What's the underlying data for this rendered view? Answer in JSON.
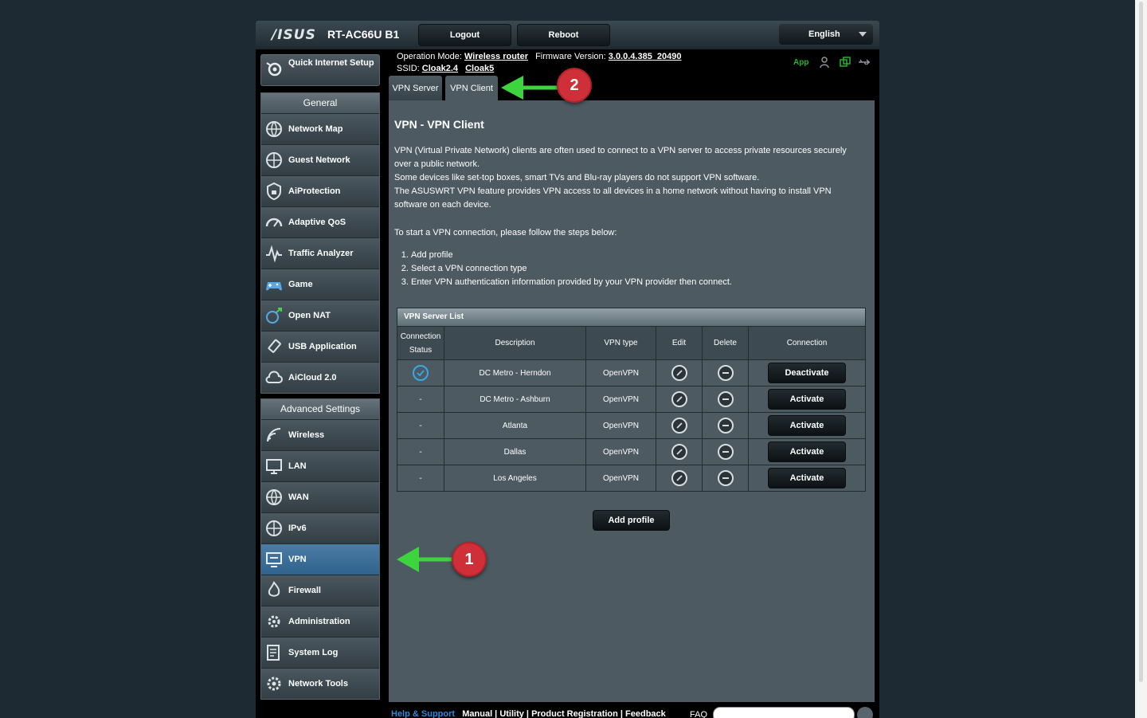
{
  "header": {
    "logo": "/ISUS",
    "model": "RT-AC66U B1",
    "logout": "Logout",
    "reboot": "Reboot",
    "language": "English"
  },
  "status": {
    "op_mode_label": "Operation Mode:",
    "op_mode_value": "Wireless router",
    "firmware_label": "Firmware Version:",
    "firmware_value": "3.0.0.4.385_20490",
    "ssid_label": "SSID:",
    "ssid_1": "Cloak2.4",
    "ssid_2": "Cloak5",
    "app_label": "App"
  },
  "sidebar": {
    "quick_setup": "Quick Internet Setup",
    "general_title": "General",
    "general_items": [
      {
        "label": "Network Map",
        "icon": "globe-network-icon"
      },
      {
        "label": "Guest Network",
        "icon": "guest-globe-icon"
      },
      {
        "label": "AiProtection",
        "icon": "shield-lock-icon"
      },
      {
        "label": "Adaptive QoS",
        "icon": "speedometer-icon"
      },
      {
        "label": "Traffic Analyzer",
        "icon": "traffic-wave-icon"
      },
      {
        "label": "Game",
        "icon": "gamepad-icon"
      },
      {
        "label": "Open NAT",
        "icon": "open-nat-icon"
      },
      {
        "label": "USB Application",
        "icon": "usb-icon"
      },
      {
        "label": "AiCloud 2.0",
        "icon": "cloud-icon"
      }
    ],
    "advanced_title": "Advanced Settings",
    "advanced_items": [
      {
        "label": "Wireless",
        "icon": "wifi-icon"
      },
      {
        "label": "LAN",
        "icon": "lan-monitor-icon"
      },
      {
        "label": "WAN",
        "icon": "wan-globe-icon"
      },
      {
        "label": "IPv6",
        "icon": "ipv6-globe-icon"
      },
      {
        "label": "VPN",
        "icon": "vpn-monitor-icon"
      },
      {
        "label": "Firewall",
        "icon": "firewall-flame-icon"
      },
      {
        "label": "Administration",
        "icon": "admin-gear-icon"
      },
      {
        "label": "System Log",
        "icon": "log-pencil-icon"
      },
      {
        "label": "Network Tools",
        "icon": "tools-gear-icon"
      }
    ]
  },
  "tabs": {
    "server": "VPN Server",
    "client": "VPN Client"
  },
  "main": {
    "title": "VPN - VPN Client",
    "desc_1": "VPN (Virtual Private Network) clients are often used to connect to a VPN server to access private resources securely over a public network.",
    "desc_2": "Some devices like set-top boxes, smart TVs and Blu-ray players do not support VPN software.",
    "desc_3": "The ASUSWRT VPN feature provides VPN access to all devices in a home network without having to install VPN software on each device.",
    "steps_intro": "To start a VPN connection, please follow the steps below:",
    "steps": [
      "Add profile",
      "Select a VPN connection type",
      "Enter VPN authentication information provided by your VPN provider then connect."
    ],
    "add_profile": "Add profile"
  },
  "table": {
    "title": "VPN Server List",
    "headers": {
      "status": "Connection Status",
      "description": "Description",
      "type": "VPN type",
      "edit": "Edit",
      "delete": "Delete",
      "connection": "Connection"
    },
    "rows": [
      {
        "status": "",
        "description": "DC Metro - Herndon",
        "type": "OpenVPN",
        "action": "Deactivate"
      },
      {
        "status": "-",
        "description": "DC Metro - Ashburn",
        "type": "OpenVPN",
        "action": "Activate"
      },
      {
        "status": "-",
        "description": "Atlanta",
        "type": "OpenVPN",
        "action": "Activate"
      },
      {
        "status": "-",
        "description": "Dallas",
        "type": "OpenVPN",
        "action": "Activate"
      },
      {
        "status": "-",
        "description": "Los Angeles",
        "type": "OpenVPN",
        "action": "Activate"
      }
    ]
  },
  "annotations": {
    "badge_1": "1",
    "badge_2": "2",
    "arrow_color": "#3ed43e",
    "badge_color": "#cf2f38"
  },
  "footer": {
    "help": "Help & Support",
    "links": "Manual | Utility | Product Registration | Feedback",
    "faq": "FAQ"
  }
}
